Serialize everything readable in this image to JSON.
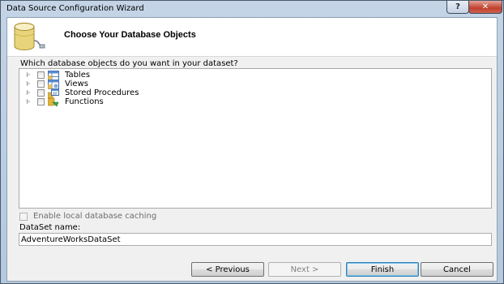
{
  "window": {
    "title": "Data Source Configuration Wizard",
    "help_label": "?",
    "close_label": "✕"
  },
  "header": {
    "title": "Choose Your Database Objects",
    "icon": "database-icon"
  },
  "prompt": "Which database objects do you want in your dataset?",
  "tree": {
    "items": [
      {
        "label": "Tables",
        "icon": "tables-icon",
        "checked": false,
        "expanded": false
      },
      {
        "label": "Views",
        "icon": "views-icon",
        "checked": false,
        "expanded": false
      },
      {
        "label": "Stored Procedures",
        "icon": "stored-procedures-icon",
        "checked": false,
        "expanded": false
      },
      {
        "label": "Functions",
        "icon": "functions-icon",
        "checked": false,
        "expanded": false
      }
    ]
  },
  "caching": {
    "label": "Enable local database caching",
    "checked": false,
    "enabled": false
  },
  "dataset": {
    "label": "DataSet name:",
    "value": "AdventureWorksDataSet"
  },
  "buttons": {
    "previous": "< Previous",
    "next": "Next >",
    "finish": "Finish",
    "cancel": "Cancel"
  },
  "colors": {
    "accent": "#3c7fb1",
    "close_red": "#c0402d",
    "frame": "#b4c8de"
  }
}
